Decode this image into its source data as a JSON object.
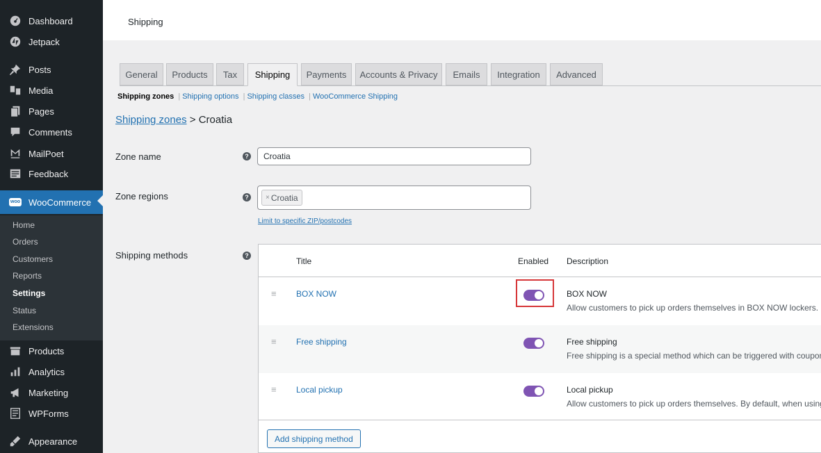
{
  "sidebar": {
    "items": [
      {
        "label": "Dashboard",
        "icon": "dashboard-icon"
      },
      {
        "label": "Jetpack",
        "icon": "jetpack-icon"
      },
      {
        "label": "Posts",
        "icon": "pin-icon"
      },
      {
        "label": "Media",
        "icon": "media-icon"
      },
      {
        "label": "Pages",
        "icon": "pages-icon"
      },
      {
        "label": "Comments",
        "icon": "comments-icon"
      },
      {
        "label": "MailPoet",
        "icon": "mailpoet-icon"
      },
      {
        "label": "Feedback",
        "icon": "feedback-icon"
      },
      {
        "label": "WooCommerce",
        "icon": "woocommerce-icon"
      },
      {
        "label": "Products",
        "icon": "products-icon"
      },
      {
        "label": "Analytics",
        "icon": "analytics-icon"
      },
      {
        "label": "Marketing",
        "icon": "marketing-icon"
      },
      {
        "label": "WPForms",
        "icon": "wpforms-icon"
      },
      {
        "label": "Appearance",
        "icon": "appearance-icon"
      }
    ],
    "woo_icon_text": "woo",
    "submenu": [
      "Home",
      "Orders",
      "Customers",
      "Reports",
      "Settings",
      "Status",
      "Extensions"
    ],
    "active_submenu": "Settings"
  },
  "header": {
    "title": "Shipping"
  },
  "tabs": [
    "General",
    "Products",
    "Tax",
    "Shipping",
    "Payments",
    "Accounts & Privacy",
    "Emails",
    "Integration",
    "Advanced"
  ],
  "active_tab": "Shipping",
  "subnav": {
    "current": "Shipping zones",
    "links": [
      "Shipping options",
      "Shipping classes",
      "WooCommerce Shipping"
    ],
    "separator": "|"
  },
  "breadcrumb": {
    "link": "Shipping zones",
    "separator": ">",
    "current": "Croatia"
  },
  "form": {
    "zone_name_label": "Zone name",
    "zone_name_value": "Croatia",
    "zone_regions_label": "Zone regions",
    "region_chips": [
      {
        "remove": "×",
        "label": "Croatia"
      }
    ],
    "limit_link": "Limit to specific ZIP/postcodes",
    "shipping_methods_label": "Shipping methods",
    "help_glyph": "?"
  },
  "methods_table": {
    "headers": {
      "title": "Title",
      "enabled": "Enabled",
      "description": "Description"
    },
    "drag_glyph": "≡",
    "rows": [
      {
        "title": "BOX NOW",
        "enabled": true,
        "desc_title": "BOX NOW",
        "desc_text": "Allow customers to pick up orders themselves in BOX NOW lockers."
      },
      {
        "title": "Free shipping",
        "enabled": true,
        "desc_title": "Free shipping",
        "desc_text": "Free shipping is a special method which can be triggered with coupons and minimum spends."
      },
      {
        "title": "Local pickup",
        "enabled": true,
        "desc_title": "Local pickup",
        "desc_text": "Allow customers to pick up orders themselves. By default, when using local pickup store base taxes will apply regardless of customer address."
      }
    ],
    "add_button": "Add shipping method"
  },
  "colors": {
    "accent": "#2271b1",
    "toggle_on": "#7f54b3",
    "highlight": "#d63638",
    "sidebar_bg": "#1d2327"
  }
}
